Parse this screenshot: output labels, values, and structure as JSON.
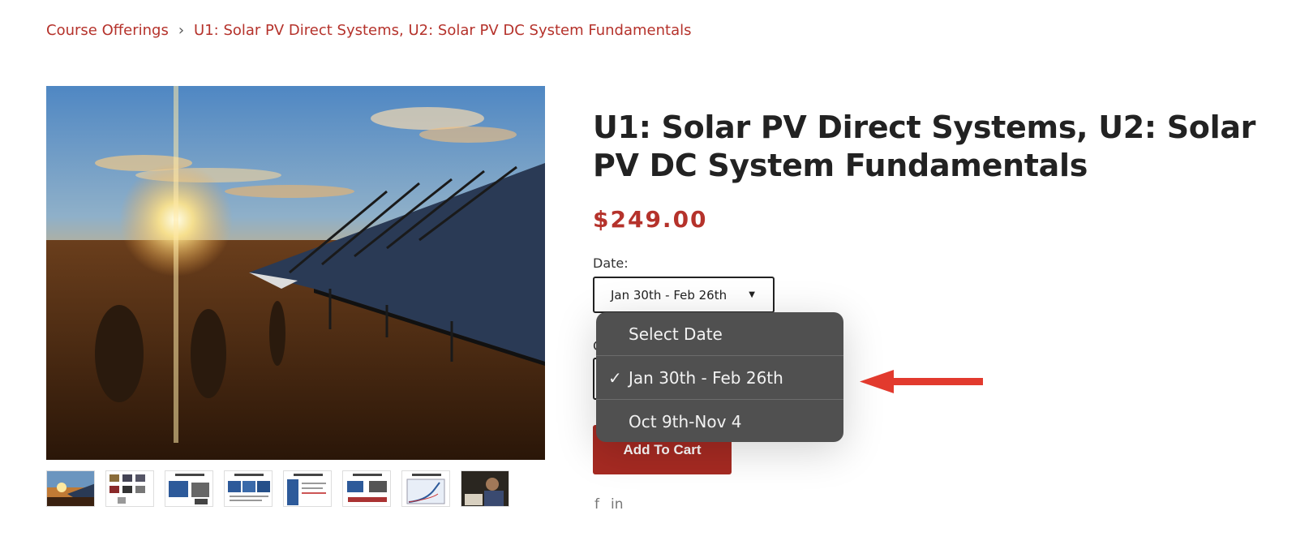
{
  "breadcrumb": {
    "parent": "Course Offerings",
    "separator": "›",
    "current": "U1: Solar PV Direct Systems, U2: Solar PV DC System Fundamentals"
  },
  "product": {
    "title": "U1: Solar PV Direct Systems, U2: Solar PV DC System Fundamentals",
    "price": "$249.00",
    "date_label": "Date:",
    "date_selected": "Jan 30th - Feb 26th",
    "quantity_label": "Q",
    "add_to_cart": "Add To Cart"
  },
  "dropdown": {
    "options": [
      {
        "label": "Select Date",
        "checked": false
      },
      {
        "label": "Jan 30th - Feb 26th",
        "checked": true
      },
      {
        "label": "Oct 9th-Nov 4",
        "checked": false
      }
    ],
    "check_mark": "✓"
  },
  "social": {
    "facebook": "f",
    "linkedin": "in"
  },
  "icons": [
    "chevron-down-icon",
    "check-icon",
    "facebook-icon",
    "linkedin-icon",
    "annotation-arrow-icon"
  ],
  "colors": {
    "brand": "#b5322b",
    "button": "#a62a22",
    "dropdown_bg": "#505050",
    "annotation_arrow": "#e23a2e"
  }
}
